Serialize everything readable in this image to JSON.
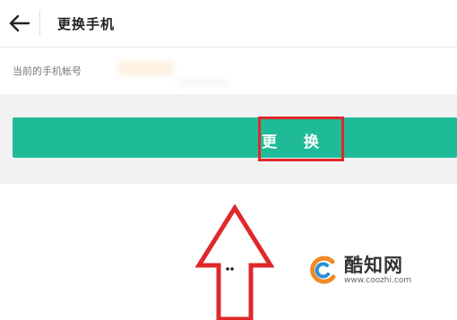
{
  "header": {
    "title": "更换手机"
  },
  "account": {
    "label": "当前的手机帐号"
  },
  "actions": {
    "change_label": "更 换"
  },
  "watermark": {
    "name": "酷知网",
    "url": "www.coozhi.com"
  },
  "colors": {
    "accent": "#1fbb98",
    "highlight": "#e0282b"
  },
  "icons": {
    "back": "back-arrow-icon",
    "pointer": "up-arrow-icon",
    "logo": "coozhi-logo-icon"
  }
}
